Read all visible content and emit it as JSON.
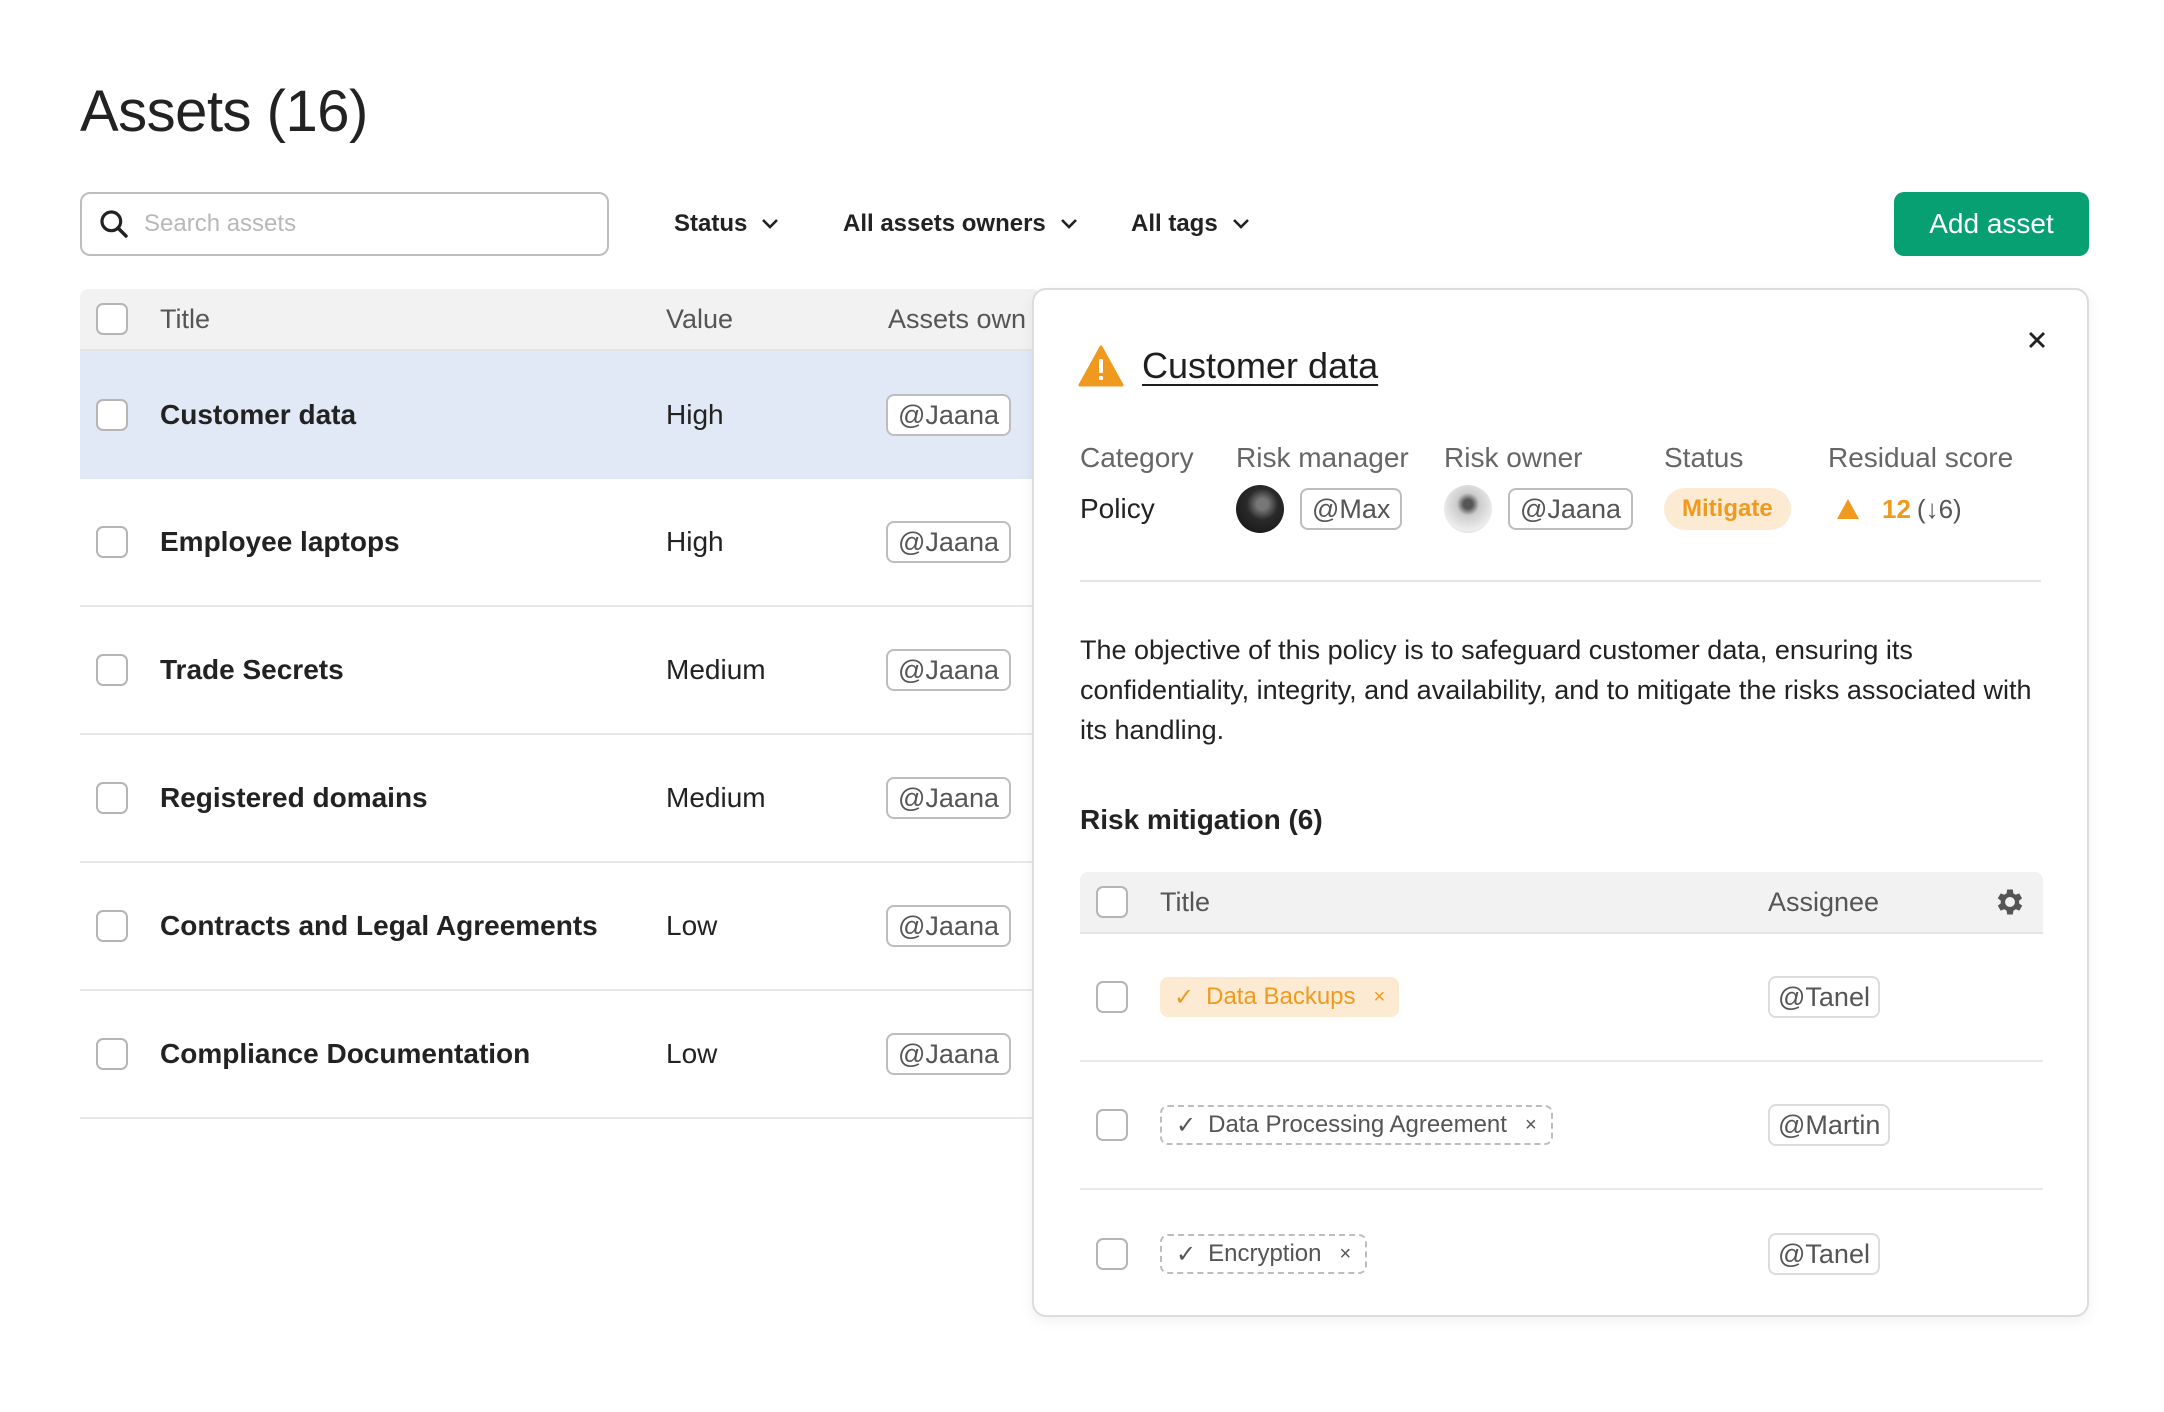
{
  "page": {
    "title": "Assets (16)"
  },
  "toolbar": {
    "search_placeholder": "Search assets",
    "search_value": "",
    "filters": [
      {
        "label": "Status"
      },
      {
        "label": "All assets owners"
      },
      {
        "label": "All tags"
      }
    ],
    "add_label": "Add asset",
    "accent_color": "#06a073"
  },
  "assets_table": {
    "columns": [
      "Title",
      "Value",
      "Assets own"
    ],
    "rows": [
      {
        "title": "Customer data",
        "value": "High",
        "owner": "@Jaana",
        "selected": true
      },
      {
        "title": "Employee laptops",
        "value": "High",
        "owner": "@Jaana",
        "selected": false
      },
      {
        "title": "Trade Secrets",
        "value": "Medium",
        "owner": "@Jaana",
        "selected": false
      },
      {
        "title": "Registered domains",
        "value": "Medium",
        "owner": "@Jaana",
        "selected": false
      },
      {
        "title": "Contracts and Legal Agreements",
        "value": "Low",
        "owner": "@Jaana",
        "selected": false
      },
      {
        "title": "Compliance Documentation",
        "value": "Low",
        "owner": "@Jaana",
        "selected": false
      }
    ]
  },
  "detail_panel": {
    "icon": "warning-icon",
    "title": "Customer data",
    "meta": {
      "category_label": "Category",
      "category_value": "Policy",
      "risk_manager_label": "Risk manager",
      "risk_manager": "@Max",
      "risk_owner_label": "Risk owner",
      "risk_owner": "@Jaana",
      "status_label": "Status",
      "status_value": "Mitigate",
      "residual_label": "Residual score",
      "residual_score": "12",
      "residual_delta": "(↓6)"
    },
    "description": "The objective of this policy is to safeguard customer data, ensuring its confidentiality, integrity, and availability, and to mitigate the risks associated with its handling.",
    "risk_mitigation": {
      "title": "Risk mitigation (6)",
      "columns": [
        "Title",
        "Assignee"
      ],
      "rows": [
        {
          "title": "Data Backups",
          "assignee": "@Tanel",
          "state": "active"
        },
        {
          "title": "Data Processing Agreement",
          "assignee": "@Martin",
          "state": "pending"
        },
        {
          "title": "Encryption",
          "assignee": "@Tanel",
          "state": "pending"
        }
      ]
    },
    "warning_color": "#ef9a1e"
  }
}
